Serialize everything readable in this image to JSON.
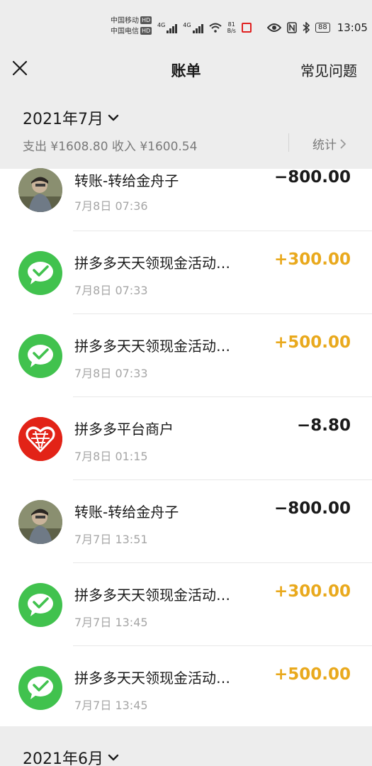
{
  "status_bar": {
    "carrier1": "中国移动",
    "carrier2": "中国电信",
    "hd_badge": "HD",
    "net1": "4G",
    "net2": "4G",
    "speed_value": "81",
    "speed_unit": "B/s",
    "battery": "88",
    "time": "13:05"
  },
  "nav": {
    "title": "账单",
    "faq_label": "常见问题"
  },
  "month_header": {
    "month": "2021年7月",
    "summary": "支出 ¥1608.80 收入 ¥1600.54",
    "stats_label": "统计"
  },
  "transactions": [
    {
      "title": "转账-转给金舟子",
      "time": "7月8日 07:36",
      "amount": "−800.00",
      "type": "expense",
      "avatar": "person-photo"
    },
    {
      "title": "拼多多天天领现金活动…",
      "time": "7月8日 07:33",
      "amount": "+300.00",
      "type": "income",
      "avatar": "wechat-pay-icon"
    },
    {
      "title": "拼多多天天领现金活动…",
      "time": "7月8日 07:33",
      "amount": "+500.00",
      "type": "income",
      "avatar": "wechat-pay-icon"
    },
    {
      "title": "拼多多平台商户",
      "time": "7月8日 01:15",
      "amount": "−8.80",
      "type": "expense",
      "avatar": "pinduoduo-logo"
    },
    {
      "title": "转账-转给金舟子",
      "time": "7月7日 13:51",
      "amount": "−800.00",
      "type": "expense",
      "avatar": "person-photo"
    },
    {
      "title": "拼多多天天领现金活动…",
      "time": "7月7日 13:45",
      "amount": "+300.00",
      "type": "income",
      "avatar": "wechat-pay-icon"
    },
    {
      "title": "拼多多天天领现金活动…",
      "time": "7月7日 13:45",
      "amount": "+500.00",
      "type": "income",
      "avatar": "wechat-pay-icon"
    }
  ],
  "next_month": {
    "month": "2021年6月"
  },
  "colors": {
    "income": "#e9a91d",
    "expense": "#1a1a1a",
    "wechat_green": "#41c24e",
    "pdd_red": "#e22317",
    "header_bg": "#ededed"
  }
}
